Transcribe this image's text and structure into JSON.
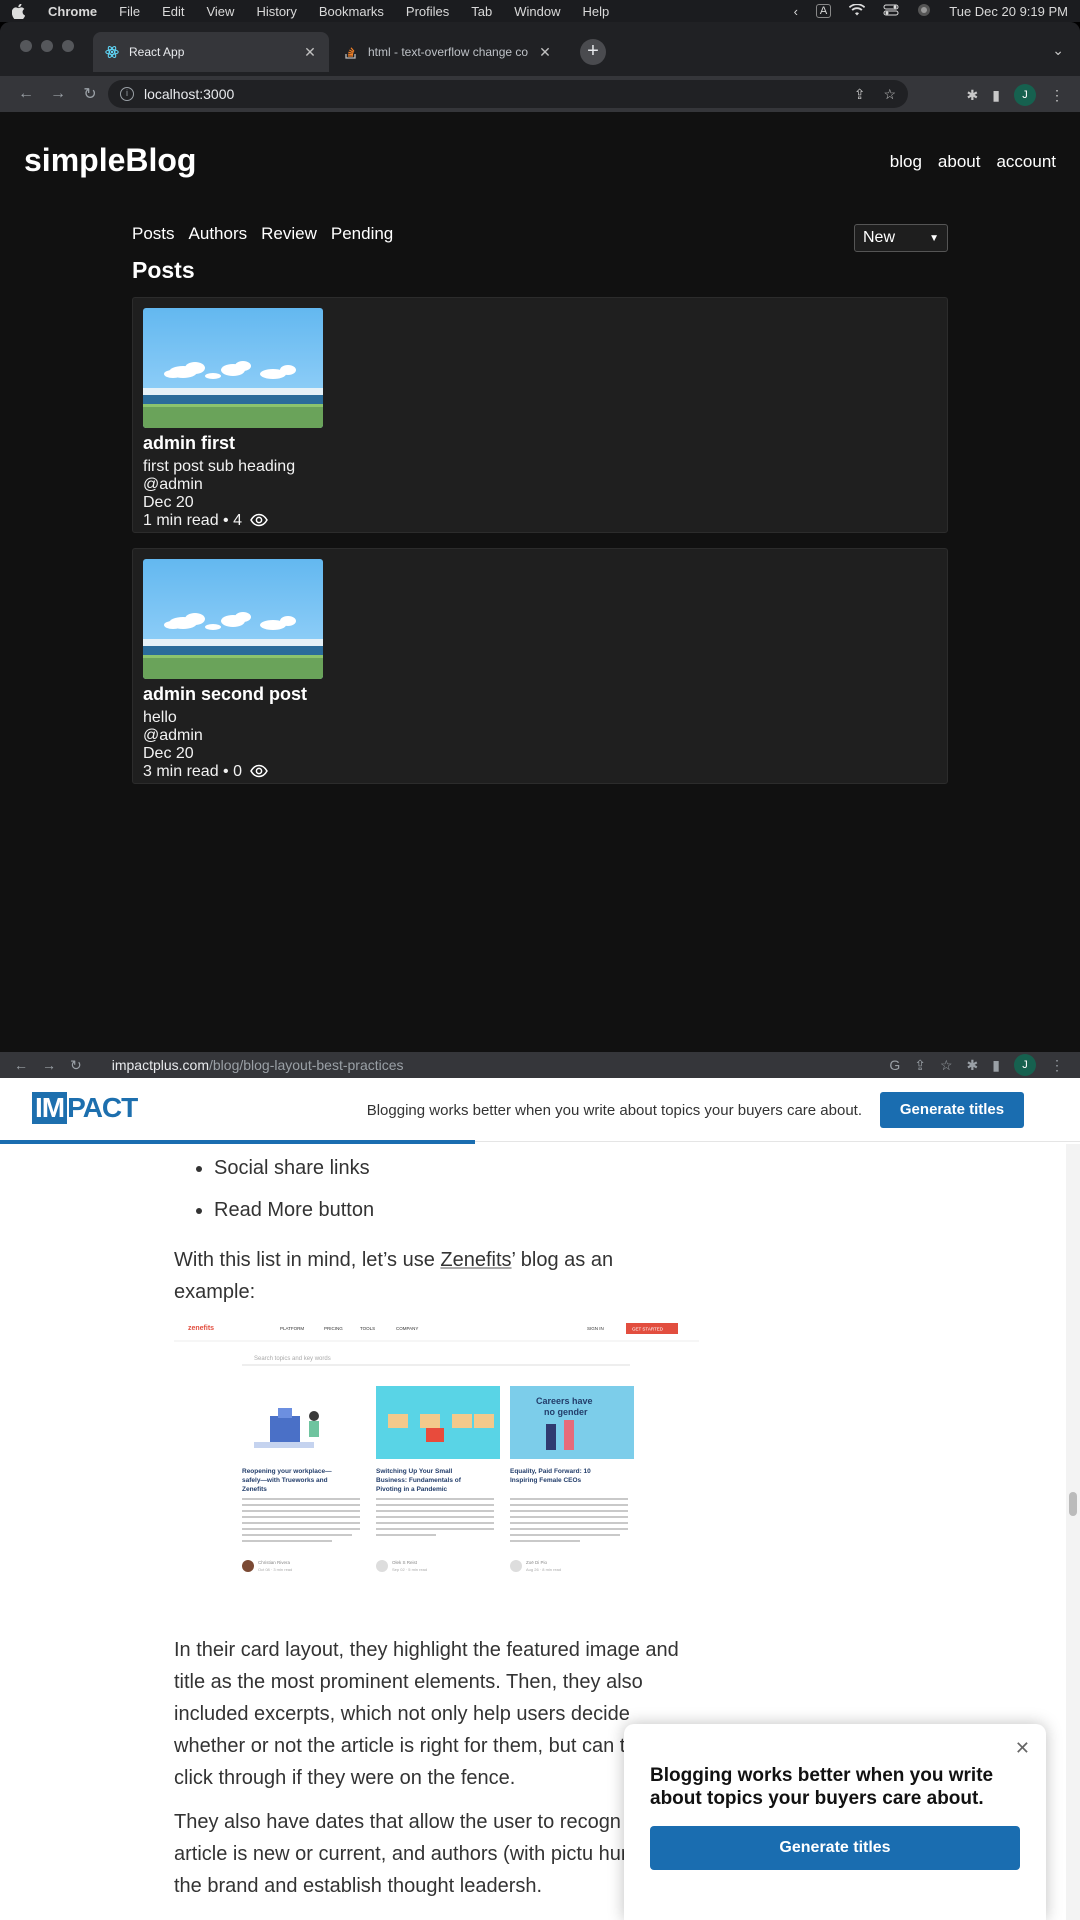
{
  "menubar": {
    "items": [
      "Chrome",
      "File",
      "Edit",
      "View",
      "History",
      "Bookmarks",
      "Profiles",
      "Tab",
      "Window",
      "Help"
    ],
    "datetime": "Tue Dec 20  9:19 PM"
  },
  "browser1": {
    "tabs": [
      {
        "title": "React App"
      },
      {
        "title": "html - text-overflow change co"
      }
    ],
    "url": "localhost:3000",
    "profile_initial": "J"
  },
  "blog": {
    "site_title": "simpleBlog",
    "nav": [
      "blog",
      "about",
      "account"
    ],
    "subnav": [
      "Posts",
      "Authors",
      "Review",
      "Pending"
    ],
    "sort": {
      "selected": "New"
    },
    "heading": "Posts",
    "posts": [
      {
        "title": "admin first",
        "subheading": "first post sub heading",
        "author": "@admin",
        "date": "Dec 20",
        "read_time": "1 min read",
        "views": "4"
      },
      {
        "title": "admin second post",
        "subheading": "hello",
        "author": "@admin",
        "date": "Dec 20",
        "read_time": "3 min read",
        "views": "0"
      }
    ]
  },
  "browser2": {
    "url_domain": "impactplus.com",
    "url_path": "/blog/blog-layout-best-practices",
    "profile_initial": "J"
  },
  "impact": {
    "logo_prefix": "IM",
    "logo_suffix": "PACT",
    "tagline": "Blogging works better when you write about topics your buyers care about.",
    "cta": "Generate titles",
    "reading_progress": 0.44,
    "article": {
      "bullets": [
        "Social share links",
        "Read More button"
      ],
      "intro_before": "With this list in mind, let’s use ",
      "intro_link": "Zenefits",
      "intro_after": "’ blog as an example:",
      "para1": "In their card layout, they highlight the featured image and title as the most prominent elements. Then, they also included excerpts, which not only help users decide whether or not the article is right for them, but can them to click through if they were on the fence.",
      "para2": "They also have dates that allow the user to recogn the article is new or current, and authors (with pictu humanize the brand and establish thought leadersh."
    },
    "zenefits_image": {
      "logo": "zenefits",
      "nav": [
        "PLATFORM",
        "PRICING",
        "TOOLS",
        "COMPANY"
      ],
      "sign_in": "SIGN IN",
      "get_started": "GET STARTED",
      "search_placeholder": "Search topics and key words",
      "cards": [
        {
          "title": "Reopening your workplace—safely—with Trueworks and Zenefits",
          "author": "Christian Rivera",
          "meta": "Oct 08 · 3 min read"
        },
        {
          "title": "Switching Up Your Small Business: Fundamentals of Pivoting in a Pandemic",
          "author": "Olek S Reist",
          "meta": "Sep 02 · 5 min read"
        },
        {
          "title": "Equality, Paid Forward: 10 Inspiring Female CEOs",
          "author": "Zoë Di Pio",
          "meta": "Aug 26 · 8 min read",
          "image_text": "Careers have no gender"
        }
      ]
    },
    "popup": {
      "text": "Blogging works better when you write about topics your buyers care about.",
      "cta": "Generate titles"
    }
  }
}
